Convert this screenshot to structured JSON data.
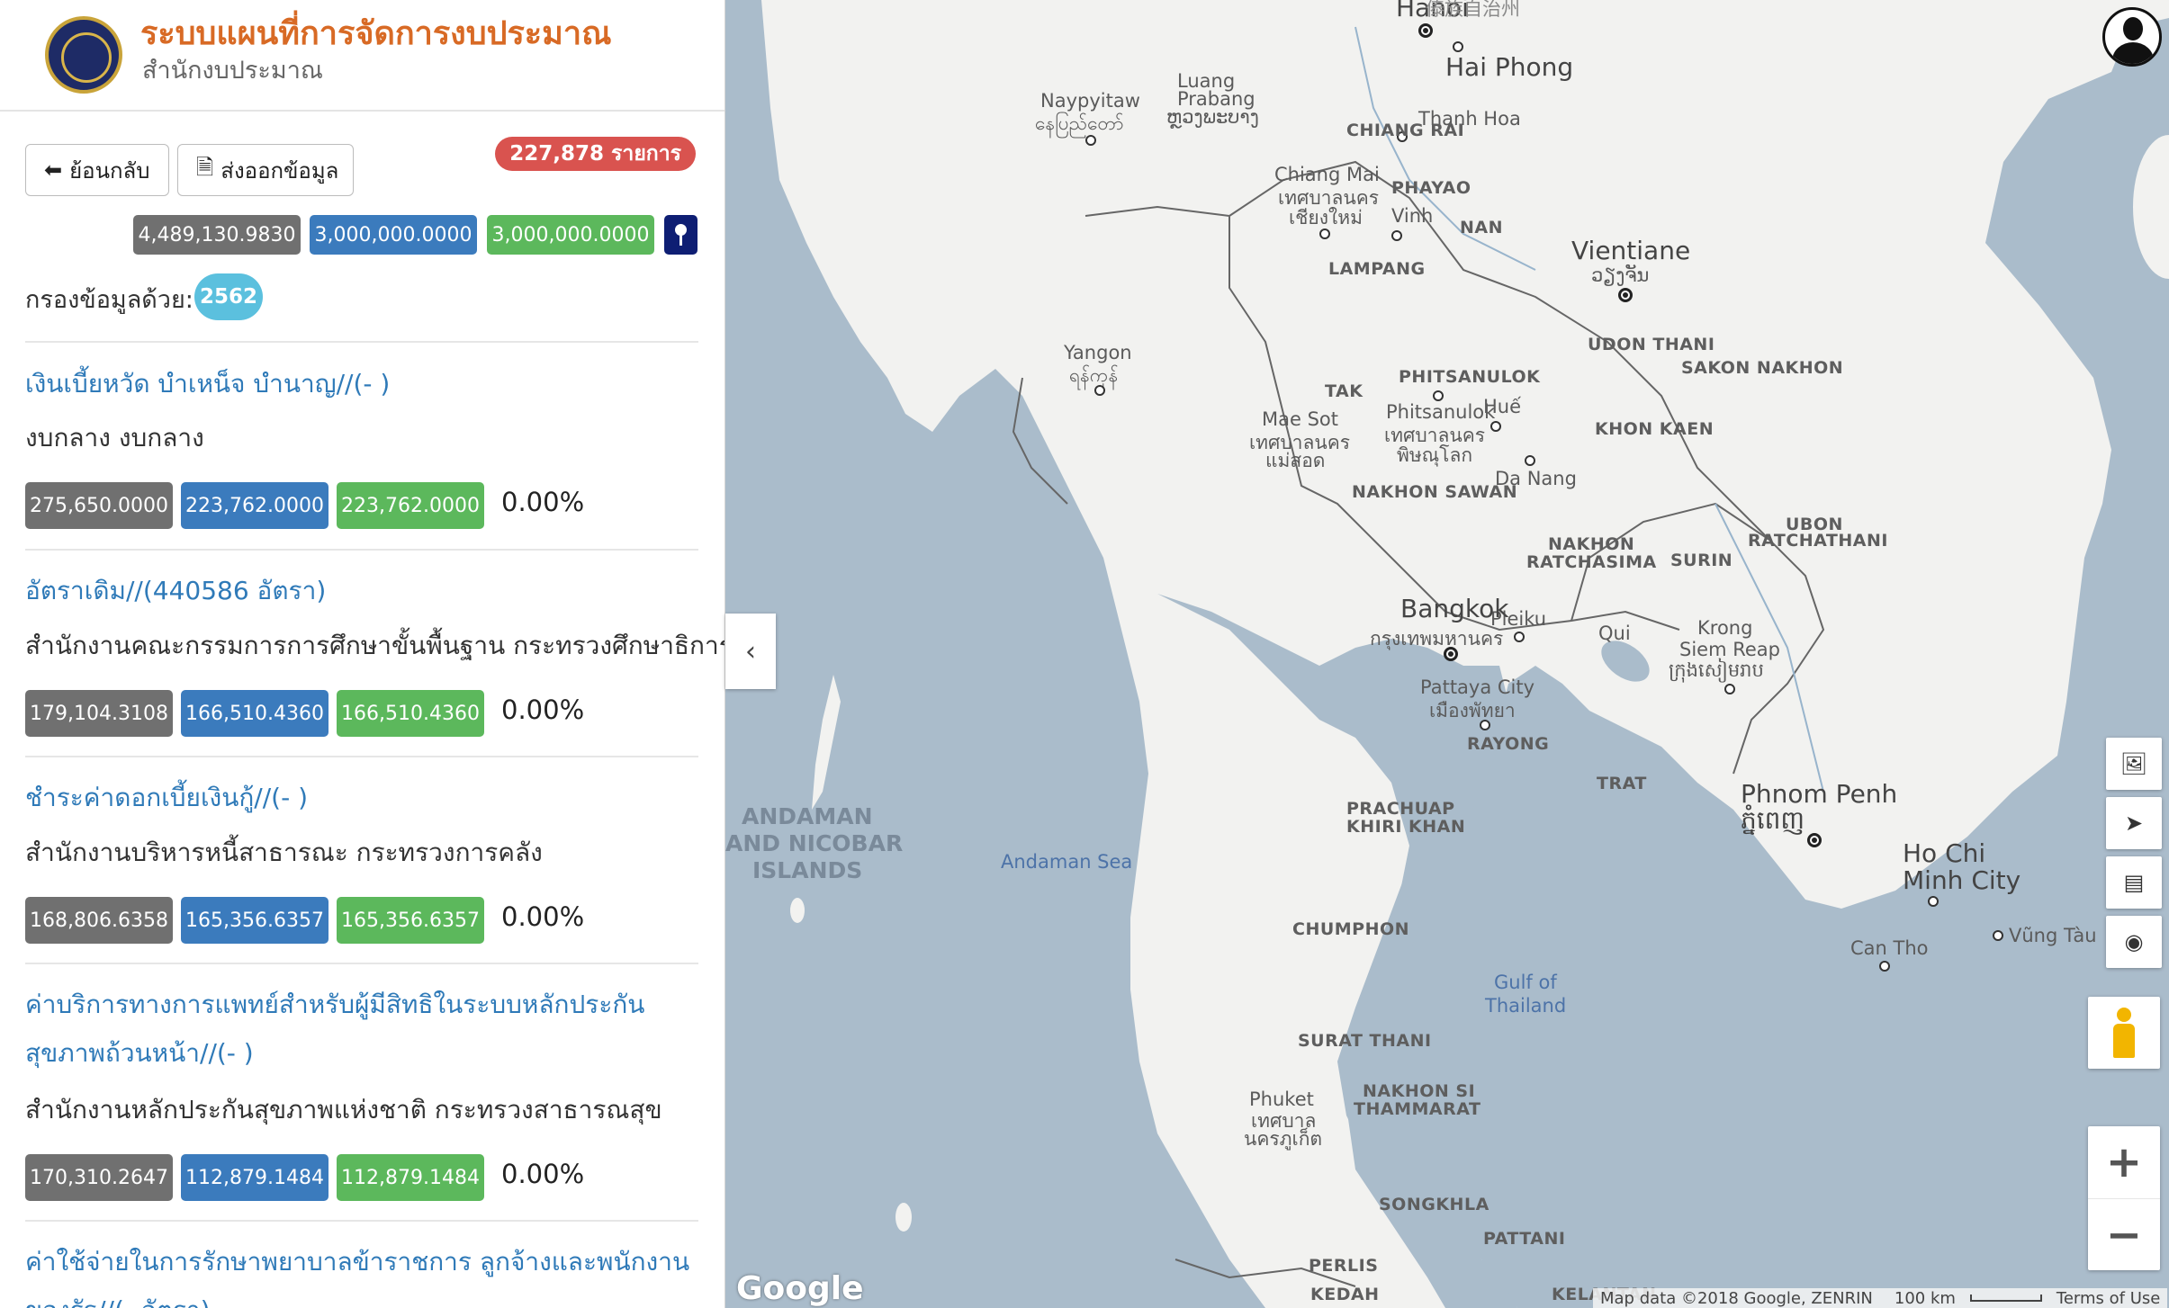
{
  "header": {
    "title": "ระบบแผนที่การจัดการงบประมาณ",
    "subtitle": "สำนักงบประมาณ"
  },
  "toolbar": {
    "back_label": "ย้อนกลับ",
    "export_label": "ส่งออกข้อมูล",
    "count_value": "227,878",
    "count_unit": "รายการ"
  },
  "summary": {
    "total_1": "4,489,130.9830",
    "total_2": "3,000,000.0000",
    "total_3": "3,000,000.0000"
  },
  "filter": {
    "label": "กรองข้อมูลด้วย:",
    "year": "2562"
  },
  "items": [
    {
      "title": "เงินเบี้ยหวัด บำเหน็จ บำนาญ//(- )",
      "org": "งบกลาง งบกลาง",
      "v1": "275,650.0000",
      "v2": "223,762.0000",
      "v3": "223,762.0000",
      "pct": "0.00%"
    },
    {
      "title": "อัตราเดิม//(440586 อัตรา)",
      "org": "สำนักงานคณะกรรมการการศึกษาขั้นพื้นฐาน กระทรวงศึกษาธิการ",
      "v1": "179,104.3108",
      "v2": "166,510.4360",
      "v3": "166,510.4360",
      "pct": "0.00%"
    },
    {
      "title": "ชำระค่าดอกเบี้ยเงินกู้//(- )",
      "org": "สำนักงานบริหารหนี้สาธารณะ กระทรวงการคลัง",
      "v1": "168,806.6358",
      "v2": "165,356.6357",
      "v3": "165,356.6357",
      "pct": "0.00%"
    },
    {
      "title": "ค่าบริการทางการแพทย์สำหรับผู้มีสิทธิในระบบหลักประกันสุขภาพถ้วนหน้า//(- )",
      "org": "สำนักงานหลักประกันสุขภาพแห่งชาติ กระทรวงสาธารณสุข",
      "v1": "170,310.2647",
      "v2": "112,879.1484",
      "v3": "112,879.1484",
      "pct": "0.00%"
    },
    {
      "title": "ค่าใช้จ่ายในการรักษาพยาบาลข้าราชการ ลูกจ้างและพนักงานของรัฐ//(- อัตรา)"
    }
  ],
  "colors": {
    "title": "#d86a25",
    "link": "#2f7ab8",
    "badge_red": "#d9534f",
    "label_gray": "#707070",
    "label_blue": "#3b7bbd",
    "label_green": "#5cb85c",
    "filter_badge": "#5bc0de",
    "pin": "#0e1e73",
    "sea": "#aabccb",
    "land": "#f2f2f0"
  },
  "map": {
    "labels": {
      "hanoi": "Hanoi",
      "haiphong": "Hai Phong",
      "thanhhoa": "Thanh Hoa",
      "vinh": "Vinh",
      "hue": "Huế",
      "danang": "Da Nang",
      "pleiku": "Pleiku",
      "quinhon": "Qui",
      "luang": "Luang",
      "prabang": "Prabang",
      "prabang_lao": "ຫຼວງພະບາງ",
      "naypyitaw": "Naypyitaw",
      "naypyitaw_my": "နေပြည်တော်",
      "chiangrai": "CHIANG RAI",
      "chiangmai": "Chiang Mai",
      "chiangmai_th1": "เทศบาลนคร",
      "chiangmai_th2": "เชียงใหม่",
      "phayao": "PHAYAO",
      "nan": "NAN",
      "lampang": "LAMPANG",
      "vientiane": "Vientiane",
      "vientiane_lao": "ວຽງຈັນ",
      "udonthani": "UDON THANI",
      "sakonnakhon": "SAKON NAKHON",
      "khonkaen": "KHON KAEN",
      "yangon": "Yangon",
      "yangon_my": "ရန်ကုန်",
      "tak": "TAK",
      "maesot": "Mae Sot",
      "maesot_th1": "เทศบาลนคร",
      "maesot_th2": "แม่สอด",
      "phitsanulok_prov": "PHITSANULOK",
      "phitsanulok": "Phitsanulok",
      "phitsanulok_th1": "เทศบาลนคร",
      "phitsanulok_th2": "พิษณุโลก",
      "nakhonsawan": "NAKHON SAWAN",
      "nakhonratchasima1": "NAKHON",
      "nakhonratchasima2": "RATCHASIMA",
      "surin": "SURIN",
      "ubon1": "UBON",
      "ubon2": "RATCHATHANI",
      "bangkok": "Bangkok",
      "bangkok_th": "กรุงเทพมหานคร",
      "pattaya": "Pattaya City",
      "pattaya_th": "เมืองพัทยา",
      "rayong": "RAYONG",
      "krong": "Krong",
      "siemreap": "Siem Reap",
      "siemreap_km": "ក្រុងសៀមរាប",
      "trat": "TRAT",
      "phnompenh": "Phnom Penh",
      "phnompenh_km": "ភ្នំពេញ",
      "hochiminh1": "Ho Chi",
      "hochiminh2": "Minh City",
      "cantho": "Can Tho",
      "vungtau": "Vũng Tàu",
      "andaman1": "ANDAMAN",
      "andaman2": "AND NICOBAR",
      "andaman3": "ISLANDS",
      "andamansea": "Andaman Sea",
      "prachuap1": "PRACHUAP",
      "prachuap2": "KHIRI KHAN",
      "gulf1": "Gulf of",
      "gulf2": "Thailand",
      "chumphon": "CHUMPHON",
      "suratthani": "SURAT THANI",
      "nakhonsi1": "NAKHON SI",
      "nakhonsi2": "THAMMARAT",
      "phuket": "Phuket",
      "phuket_th1": "เทศบาล",
      "phuket_th2": "นครภูเก็ต",
      "songkhla": "SONGKHLA",
      "pattani": "PATTANI",
      "perlis": "PERLIS",
      "kedah": "KEDAH",
      "kelantan": "KELANTAN",
      "top_cn": "傣族自治州"
    },
    "collapse_icon": "chevron-left-icon",
    "attribution": "Map data ©2018 Google, ZENRIN",
    "scale": "100 km",
    "terms": "Terms of Use",
    "google": "Google"
  }
}
